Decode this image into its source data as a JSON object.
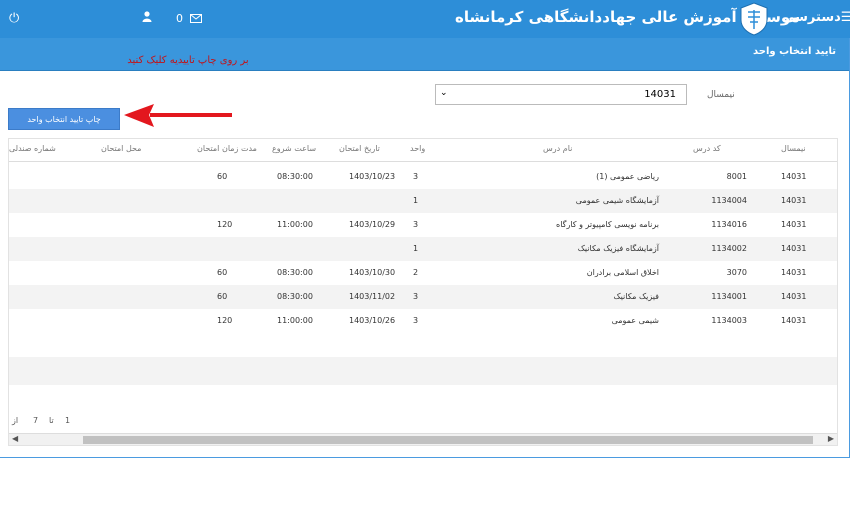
{
  "topbar": {
    "title": "موسسه آموزش عالی جهاددانشگاهی کرمانشاه",
    "menu_label": "دسترسی",
    "mail_count": "0",
    "power_icon": "power-icon",
    "user_icon": "user-icon",
    "mail_icon": "envelope-icon",
    "menu_icon": "hamburger-icon",
    "color": "#2d8ed8"
  },
  "page": {
    "title": "تایید انتخاب واحد"
  },
  "annotation": {
    "text": "بر روی چاپ تاییدیه کلیک کنید",
    "color": "#c0151b"
  },
  "filter": {
    "label": "نیمسال",
    "value": "14031"
  },
  "print_button": {
    "label": "چاپ تایید انتخاب واحد"
  },
  "table": {
    "columns": [
      "نیمسال",
      "کد درس",
      "نام درس",
      "واحد",
      "تاریخ امتحان",
      "ساعت شروع",
      "مدت زمان امتحان",
      "محل امتحان",
      "شماره صندلی"
    ],
    "rows": [
      {
        "term": "14031",
        "code": "8001",
        "name": "ریاضی عمومی (1)",
        "units": "3",
        "date": "1403/10/23",
        "time": "08:30:00",
        "duration": "60"
      },
      {
        "term": "14031",
        "code": "1134004",
        "name": "آزمایشگاه شیمی عمومی",
        "units": "1",
        "date": "",
        "time": "",
        "duration": ""
      },
      {
        "term": "14031",
        "code": "1134016",
        "name": "برنامه نویسی کامپیوتر و کارگاه",
        "units": "3",
        "date": "1403/10/29",
        "time": "11:00:00",
        "duration": "120"
      },
      {
        "term": "14031",
        "code": "1134002",
        "name": "آزمایشگاه فیزیک مکانیک",
        "units": "1",
        "date": "",
        "time": "",
        "duration": ""
      },
      {
        "term": "14031",
        "code": "3070",
        "name": "اخلاق اسلامی برادران",
        "units": "2",
        "date": "1403/10/30",
        "time": "08:30:00",
        "duration": "60"
      },
      {
        "term": "14031",
        "code": "1134001",
        "name": "فیزیک مکانیک",
        "units": "3",
        "date": "1403/11/02",
        "time": "08:30:00",
        "duration": "60"
      },
      {
        "term": "14031",
        "code": "1134003",
        "name": "شیمی عمومی",
        "units": "3",
        "date": "1403/10/26",
        "time": "11:00:00",
        "duration": "120"
      }
    ]
  },
  "pager": {
    "from": "1",
    "to_label": "تا",
    "to": "7",
    "of_label": "از"
  }
}
